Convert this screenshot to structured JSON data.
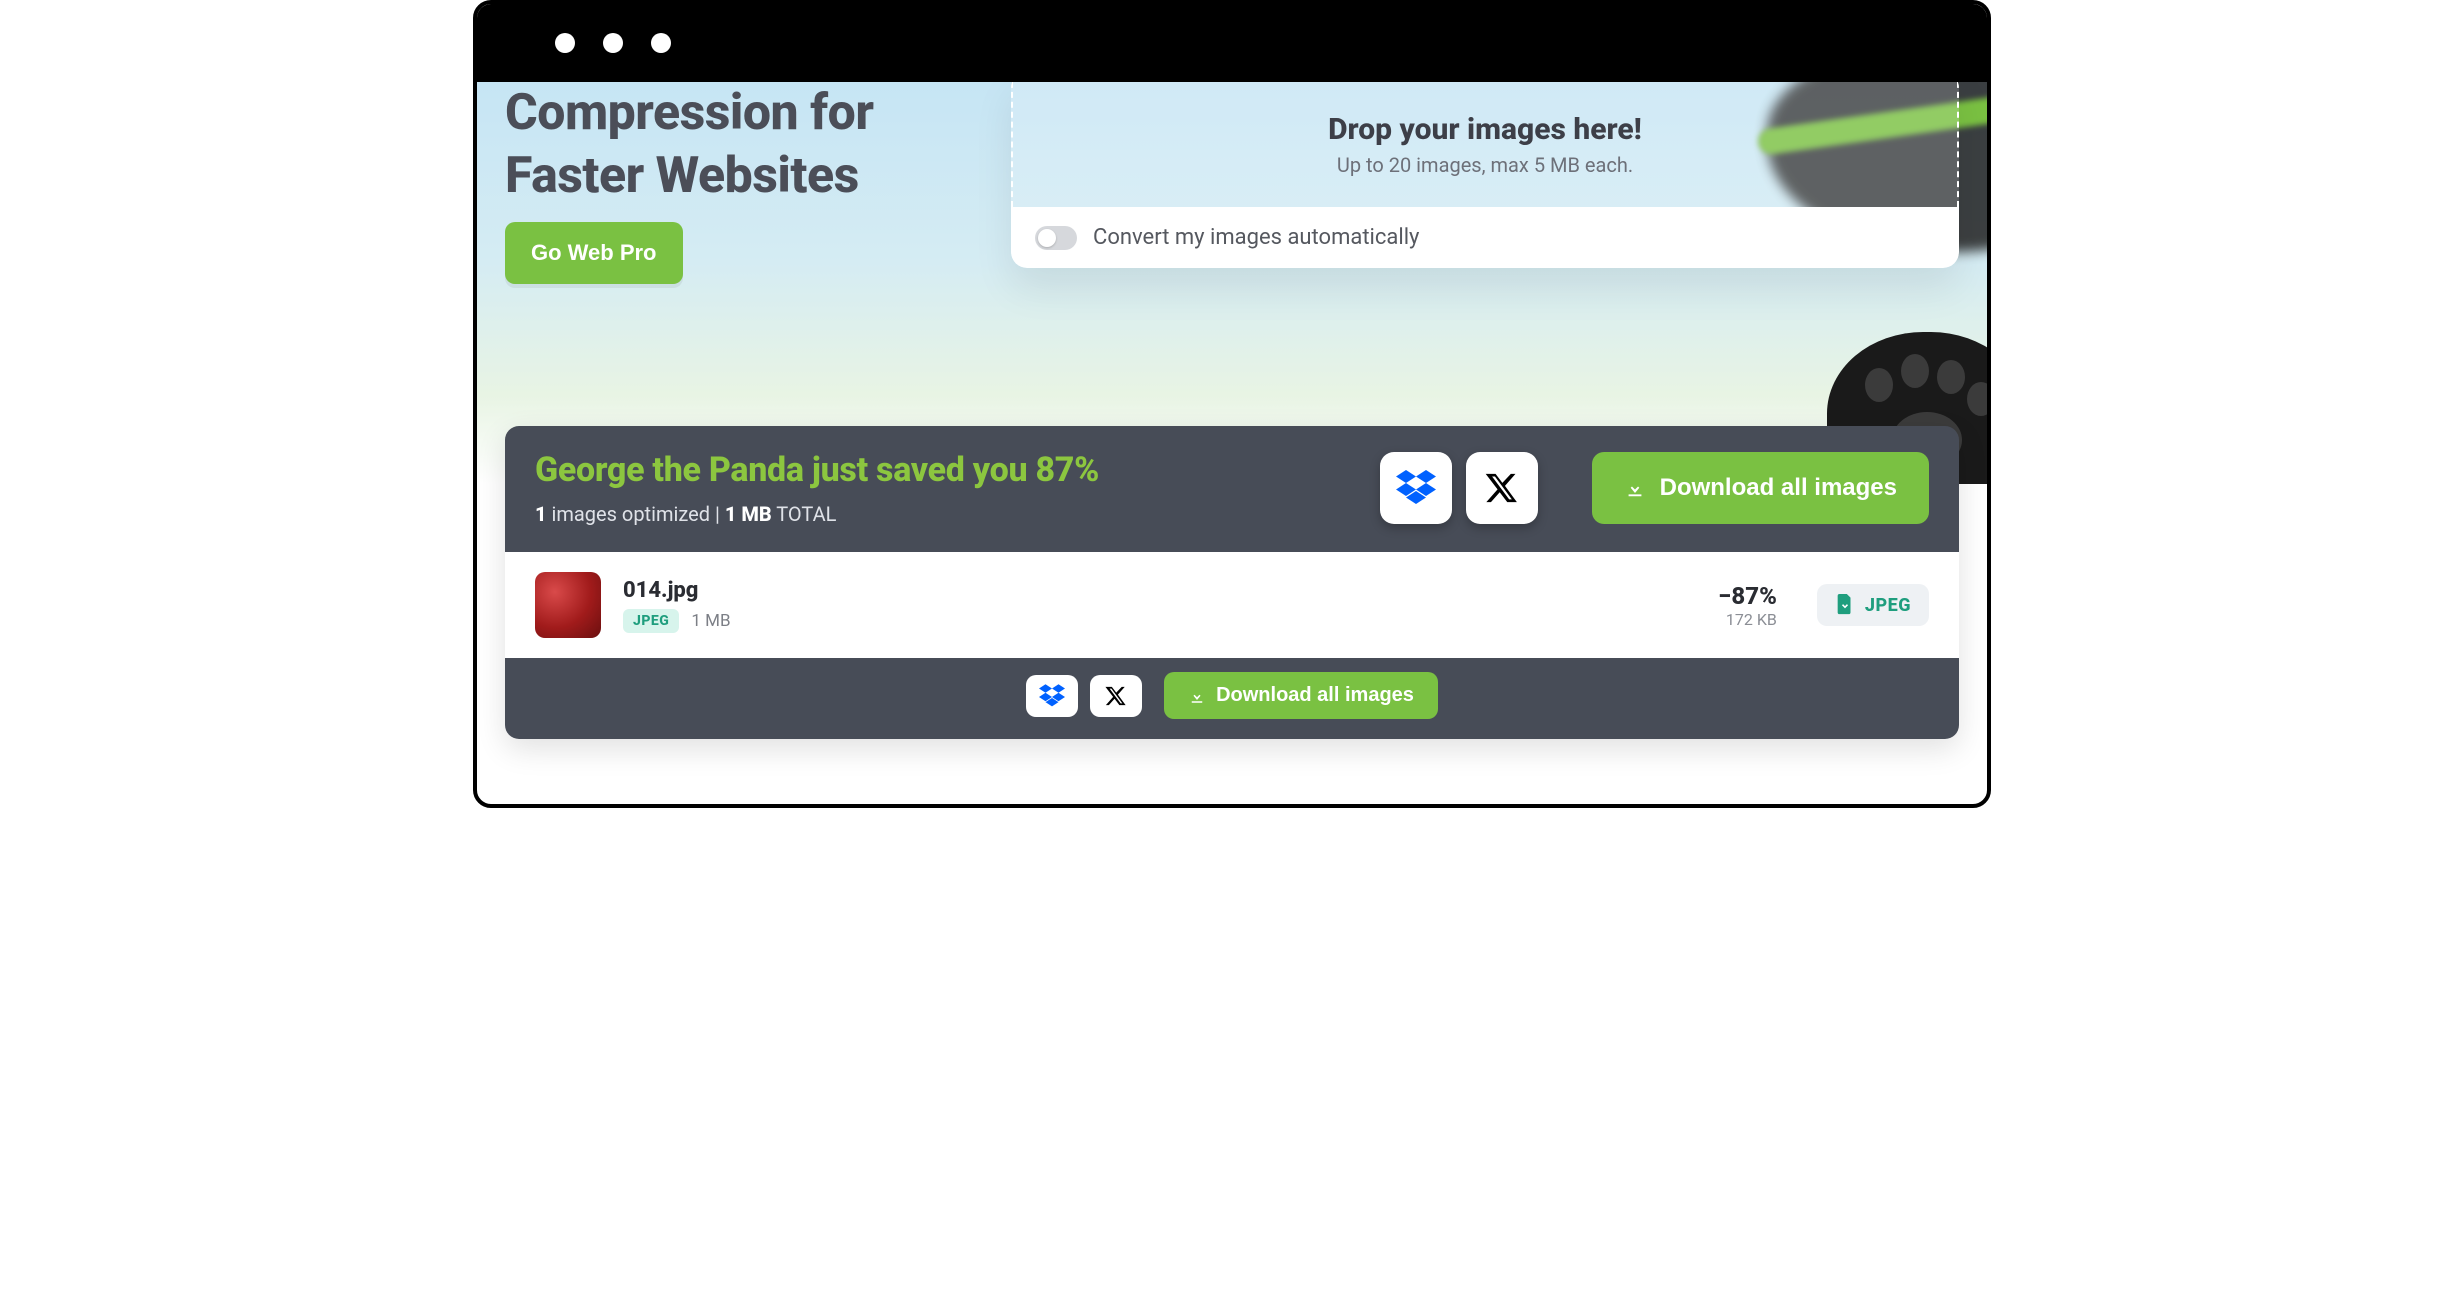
{
  "hero": {
    "headline_line1": "Compression for",
    "headline_line2": "Faster Websites",
    "cta_label": "Go Web Pro"
  },
  "dropzone": {
    "title": "Drop your images here!",
    "subtitle": "Up to 20 images, max 5 MB each.",
    "convert_label": "Convert my images automatically"
  },
  "results": {
    "saved_line": "George the Panda just saved you 87%",
    "count": "1",
    "count_suffix": " images optimized",
    "separator": "  |  ",
    "total_size": "1 MB",
    "total_suffix": " TOTAL",
    "download_all_label": "Download all images"
  },
  "file": {
    "name": "014.jpg",
    "input_format": "JPEG",
    "input_size": "1 MB",
    "reduction": "−87%",
    "output_size": "172 KB",
    "output_format": "JPEG"
  },
  "icons": {
    "dropbox": "dropbox-icon",
    "x": "x-icon",
    "download": "download-icon"
  },
  "colors": {
    "accent": "#7ac142",
    "panel": "#474c57",
    "teal": "#1f9e7e",
    "dropbox_blue": "#0061ff"
  }
}
